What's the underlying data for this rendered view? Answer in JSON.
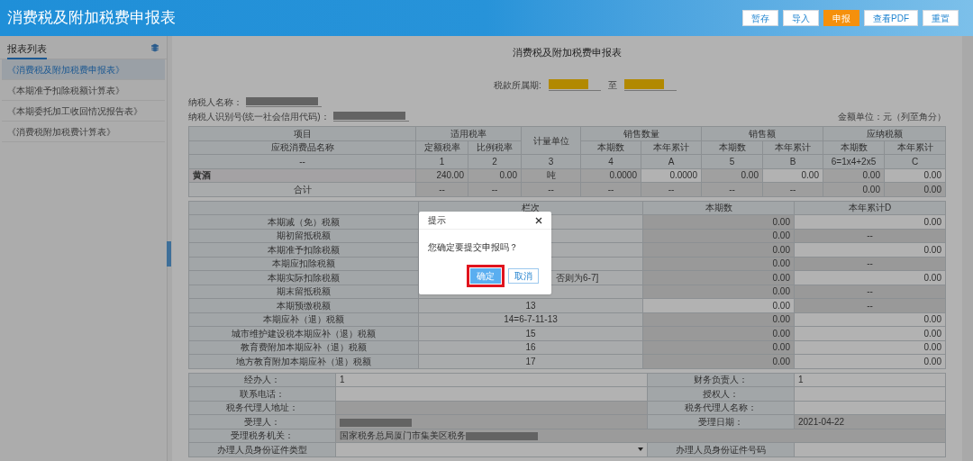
{
  "header": {
    "title": "消费税及附加税费申报表",
    "buttons": [
      {
        "label": "暂存",
        "kind": "default"
      },
      {
        "label": "导入",
        "kind": "default"
      },
      {
        "label": "申报",
        "kind": "primary"
      },
      {
        "label": "查看PDF",
        "kind": "default"
      },
      {
        "label": "重置",
        "kind": "default"
      }
    ]
  },
  "sidebar": {
    "title": "报表列表",
    "items": [
      {
        "label": "《消费税及附加税费申报表》",
        "selected": true
      },
      {
        "label": "《本期准予扣除税额计算表》",
        "selected": false
      },
      {
        "label": "《本期委托加工收回情况报告表》",
        "selected": false
      },
      {
        "label": "《消费税附加税费计算表》",
        "selected": false
      }
    ]
  },
  "form": {
    "title": "消费税及附加税费申报表",
    "period_label": "税款所属期:",
    "period_to_label": "至",
    "period_highlighted": true,
    "taxpayer_name_label": "纳税人名称：",
    "taxpayer_name_redacted": true,
    "taxpayer_id_label": "纳税人识别号(统一社会信用代码)：",
    "taxpayer_id_redacted": true,
    "unit_note": "金额单位：元（列至角分）",
    "main_table": {
      "header_groups": [
        "项目",
        "适用税率",
        "计量单位",
        "销售数量",
        "销售额",
        "应纳税额"
      ],
      "sub_headers": [
        "应税消费品名称",
        "定额税率",
        "比例税率",
        "本期数",
        "本年累计",
        "本期数",
        "本年累计",
        "本期数",
        "本年累计"
      ],
      "index_row": [
        "--",
        "1",
        "2",
        "3",
        "4",
        "A",
        "5",
        "B",
        "6=1x4+2x5",
        "C"
      ],
      "rows": [
        {
          "cells": [
            "黄酒",
            "240.00",
            "0.00",
            "吨",
            "0.0000",
            "0.0000",
            "0.00",
            "0.00",
            "0.00",
            "0.00"
          ],
          "kind": "item"
        },
        {
          "cells": [
            "合计",
            "--",
            "--",
            "--",
            "--",
            "--",
            "--",
            "--",
            "0.00",
            "0.00"
          ],
          "kind": "total"
        }
      ]
    },
    "tax_table": {
      "columns": [
        "栏次",
        "本期数",
        "本年累计D"
      ],
      "rows": [
        {
          "item": "本期减（免）税额",
          "current": "0.00",
          "current_editable": false,
          "ytd": "0.00",
          "ytd_editable": true
        },
        {
          "item": "期初留抵税额",
          "current": "0.00",
          "current_editable": false,
          "ytd": "--",
          "ytd_editable": false
        },
        {
          "item": "本期准予扣除税额",
          "current": "0.00",
          "current_editable": false,
          "ytd": "0.00",
          "ytd_editable": true
        },
        {
          "item": "本期应扣除税额",
          "current": "0.00",
          "current_editable": false,
          "ytd": "--",
          "ytd_editable": false
        },
        {
          "item": "本期实际扣除税额",
          "line": "否则为6-7]",
          "line_cut": true,
          "current": "0.00",
          "current_editable": false,
          "ytd": "0.00",
          "ytd_editable": true
        },
        {
          "item": "期末留抵税额",
          "current": "0.00",
          "current_editable": false,
          "ytd": "--",
          "ytd_editable": false
        },
        {
          "item": "本期预缴税额",
          "line": "13",
          "current": "0.00",
          "current_editable": true,
          "ytd": "--",
          "ytd_editable": false
        },
        {
          "item": "本期应补（退）税额",
          "line": "14=6-7-11-13",
          "current": "0.00",
          "current_editable": false,
          "ytd": "0.00",
          "ytd_editable": true
        },
        {
          "item": "城市维护建设税本期应补（退）税额",
          "line": "15",
          "current": "0.00",
          "current_editable": false,
          "ytd": "0.00",
          "ytd_editable": true
        },
        {
          "item": "教育费附加本期应补（退）税额",
          "line": "16",
          "current": "0.00",
          "current_editable": false,
          "ytd": "0.00",
          "ytd_editable": true
        },
        {
          "item": "地方教育附加本期应补（退）税额",
          "line": "17",
          "current": "0.00",
          "current_editable": false,
          "ytd": "0.00",
          "ytd_editable": true
        }
      ]
    },
    "signoff": [
      {
        "kind": "pair",
        "label": "经办人：",
        "value": "1",
        "label2": "财务负责人：",
        "value2": "1"
      },
      {
        "kind": "pair",
        "label": "联系电话：",
        "label2": "授权人："
      },
      {
        "kind": "pair",
        "label": "税务代理人地址：",
        "label2": "税务代理人名称："
      },
      {
        "kind": "pair",
        "label": "受理人：",
        "value_redacted": true,
        "label2": "受理日期：",
        "value2": "2021-04-22"
      },
      {
        "kind": "wide",
        "label": "受理税务机关：",
        "value": "国家税务总局厦门市集美区税务",
        "value_redacted": true
      },
      {
        "kind": "select",
        "label": "办理人员身份证件类型",
        "label2": "办理人员身份证件号码"
      }
    ]
  },
  "dialog": {
    "title": "提示",
    "message": "您确定要提交申报吗？",
    "confirm": "确定",
    "cancel": "取消",
    "confirm_highlighted": true
  }
}
